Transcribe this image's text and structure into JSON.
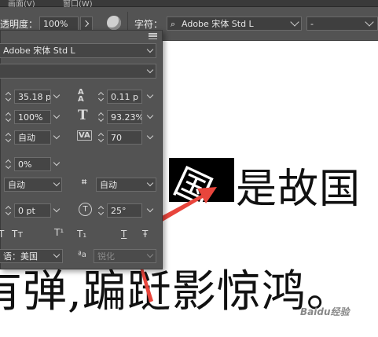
{
  "menubar": {
    "item1": "画面(V)",
    "item2": "窗口(W)"
  },
  "options_bar": {
    "opacity_label": "透明度：",
    "opacity_value": "100%",
    "char_label": "字符：",
    "font_family": "Adobe 宋体 Std L",
    "font_style": "-"
  },
  "character_panel": {
    "font_family": "Adobe 宋体 Std L",
    "font_style": "",
    "font_size": "35.18 p",
    "leading": "0.11 p",
    "vertical_scale": "100%",
    "horizontal_scale": "93.23%",
    "kerning": "自动",
    "tracking": "70",
    "tsume": "0%",
    "mojikumi": "自动",
    "aki_label": "自动",
    "baseline_shift": "0 pt",
    "rotation": "25°",
    "style_buttons": [
      "T",
      "Tт",
      "T¹",
      "T₁",
      "T",
      "Ŧ"
    ],
    "language": "语：美国",
    "antialias_icon": "ªa",
    "antialias": "锐化"
  },
  "document": {
    "line1_highlight": "国",
    "line1_rest": "是故国",
    "line2": "有弹,蹁跹影惊鸿。",
    "watermark": "Baidu经验"
  },
  "colors": {
    "panel": "#535353",
    "arrow": "#e8453c",
    "selection": "#000000"
  }
}
